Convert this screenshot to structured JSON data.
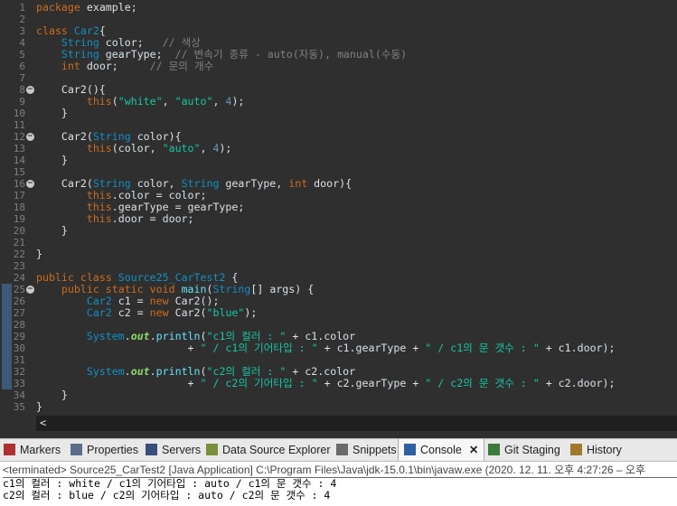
{
  "editor": {
    "line_numbers": [
      "1",
      "2",
      "3",
      "4",
      "5",
      "6",
      "7",
      "8",
      "9",
      "10",
      "11",
      "12",
      "13",
      "14",
      "15",
      "16",
      "17",
      "18",
      "19",
      "20",
      "21",
      "22",
      "23",
      "24",
      "25",
      "26",
      "27",
      "28",
      "29",
      "30",
      "31",
      "32",
      "33",
      "34",
      "35"
    ],
    "fold_markers": [
      "8",
      "12",
      "16",
      "25"
    ],
    "breakpoint_lines": [
      "25",
      "26",
      "27",
      "28",
      "29",
      "30",
      "31",
      "32",
      "33"
    ],
    "fold_glyph": "−",
    "lines": [
      [
        [
          "package",
          "k"
        ],
        [
          " example;",
          ""
        ]
      ],
      [],
      [
        [
          "class",
          "k"
        ],
        [
          " ",
          ""
        ],
        [
          "Car2",
          "cls"
        ],
        [
          "{",
          ""
        ]
      ],
      [
        [
          "    ",
          "w"
        ],
        [
          "String",
          "cls"
        ],
        [
          " color;   ",
          ""
        ],
        [
          "// 색상",
          "c"
        ]
      ],
      [
        [
          "    ",
          "w"
        ],
        [
          "String",
          "cls"
        ],
        [
          " gearType;  ",
          ""
        ],
        [
          "// 변속기 종류 - auto(자동), manual(수동)",
          "c"
        ]
      ],
      [
        [
          "    ",
          "w"
        ],
        [
          "int",
          "k"
        ],
        [
          " door;     ",
          ""
        ],
        [
          "// 문의 개수",
          "c"
        ]
      ],
      [
        [
          "    ",
          "w"
        ]
      ],
      [
        [
          "    ",
          "w"
        ],
        [
          "Car2(){",
          ""
        ]
      ],
      [
        [
          "        ",
          "w"
        ],
        [
          "this",
          "k"
        ],
        [
          "(",
          ""
        ],
        [
          "\"white\"",
          "s"
        ],
        [
          ", ",
          ""
        ],
        [
          "\"auto\"",
          "s"
        ],
        [
          ", ",
          ""
        ],
        [
          "4",
          "n"
        ],
        [
          ");",
          ""
        ]
      ],
      [
        [
          "    ",
          "w"
        ],
        [
          "}",
          ""
        ]
      ],
      [
        [
          "    ",
          "w"
        ]
      ],
      [
        [
          "    ",
          "w"
        ],
        [
          "Car2(",
          ""
        ],
        [
          "String",
          "cls"
        ],
        [
          " color){",
          ""
        ]
      ],
      [
        [
          "        ",
          "w"
        ],
        [
          "this",
          "k"
        ],
        [
          "(color, ",
          ""
        ],
        [
          "\"auto\"",
          "s"
        ],
        [
          ", ",
          ""
        ],
        [
          "4",
          "n"
        ],
        [
          ");",
          ""
        ]
      ],
      [
        [
          "    ",
          "w"
        ],
        [
          "}",
          ""
        ]
      ],
      [
        [
          "    ",
          "w"
        ]
      ],
      [
        [
          "    ",
          "w"
        ],
        [
          "Car2(",
          ""
        ],
        [
          "String",
          "cls"
        ],
        [
          " color, ",
          ""
        ],
        [
          "String",
          "cls"
        ],
        [
          " gearType, ",
          ""
        ],
        [
          "int",
          "k"
        ],
        [
          " door){",
          ""
        ]
      ],
      [
        [
          "        ",
          "w"
        ],
        [
          "this",
          "k"
        ],
        [
          ".color = color;",
          ""
        ]
      ],
      [
        [
          "        ",
          "w"
        ],
        [
          "this",
          "k"
        ],
        [
          ".gearType = gearType;",
          ""
        ]
      ],
      [
        [
          "        ",
          "w"
        ],
        [
          "this",
          "k"
        ],
        [
          ".door = door;",
          ""
        ]
      ],
      [
        [
          "    ",
          "w"
        ],
        [
          "}",
          ""
        ]
      ],
      [
        [
          "    ",
          "w"
        ]
      ],
      [
        [
          "}",
          ""
        ]
      ],
      [],
      [
        [
          "public",
          "k"
        ],
        [
          " ",
          ""
        ],
        [
          "class",
          "k"
        ],
        [
          " ",
          ""
        ],
        [
          "Source25_CarTest2",
          "cls"
        ],
        [
          " {",
          ""
        ]
      ],
      [
        [
          "    ",
          "w"
        ],
        [
          "public",
          "k"
        ],
        [
          " ",
          ""
        ],
        [
          "static",
          "k"
        ],
        [
          " ",
          ""
        ],
        [
          "void",
          "k"
        ],
        [
          " ",
          ""
        ],
        [
          "main",
          "f"
        ],
        [
          "(",
          ""
        ],
        [
          "String",
          "cls"
        ],
        [
          "[] args) {",
          ""
        ]
      ],
      [
        [
          "        ",
          "w"
        ],
        [
          "Car2",
          "cls"
        ],
        [
          " c1 = ",
          ""
        ],
        [
          "new",
          "k"
        ],
        [
          " Car2();",
          ""
        ]
      ],
      [
        [
          "        ",
          "w"
        ],
        [
          "Car2",
          "cls"
        ],
        [
          " c2 = ",
          ""
        ],
        [
          "new",
          "k"
        ],
        [
          " Car2(",
          ""
        ],
        [
          "\"blue\"",
          "s"
        ],
        [
          ");",
          ""
        ]
      ],
      [
        [
          "        ",
          "w"
        ]
      ],
      [
        [
          "        ",
          "w"
        ],
        [
          "System",
          "cls"
        ],
        [
          ".",
          ""
        ],
        [
          "out",
          "st"
        ],
        [
          ".",
          ""
        ],
        [
          "println",
          "f"
        ],
        [
          "(",
          ""
        ],
        [
          "\"c1의 컬러 : \"",
          "s"
        ],
        [
          " + c1.color",
          ""
        ]
      ],
      [
        [
          "                        ",
          "w"
        ],
        [
          "+ ",
          ""
        ],
        [
          "\" / c1의 기어타입 : \"",
          "s"
        ],
        [
          " + c1.gearType + ",
          ""
        ],
        [
          "\" / c1의 문 갯수 : \"",
          "s"
        ],
        [
          " + c1.door);",
          ""
        ]
      ],
      [
        [
          "        ",
          "w"
        ]
      ],
      [
        [
          "        ",
          "w"
        ],
        [
          "System",
          "cls"
        ],
        [
          ".",
          ""
        ],
        [
          "out",
          "st"
        ],
        [
          ".",
          ""
        ],
        [
          "println",
          "f"
        ],
        [
          "(",
          ""
        ],
        [
          "\"c2의 컬러 : \"",
          "s"
        ],
        [
          " + c2.color",
          ""
        ]
      ],
      [
        [
          "                        ",
          "w"
        ],
        [
          "+ ",
          ""
        ],
        [
          "\" / c2의 기어타입 : \"",
          "s"
        ],
        [
          " + c2.gearType + ",
          ""
        ],
        [
          "\" / c2의 문 갯수 : \"",
          "s"
        ],
        [
          " + c2.door);",
          ""
        ]
      ],
      [
        [
          "    ",
          "w"
        ],
        [
          "}",
          ""
        ]
      ],
      [
        [
          "}",
          ""
        ]
      ]
    ]
  },
  "hscroll_arrow": "<",
  "tabs": [
    {
      "label": "Markers",
      "icon": "markers-icon",
      "color": "#b03030"
    },
    {
      "label": "Properties",
      "icon": "properties-icon",
      "color": "#5a6d8a"
    },
    {
      "label": "Servers",
      "icon": "servers-icon",
      "color": "#3a4f7a"
    },
    {
      "label": "Data Source Explorer",
      "icon": "data-source-explorer-icon",
      "color": "#7a8f3a"
    },
    {
      "label": "Snippets",
      "icon": "snippets-icon",
      "color": "#6a6a6a"
    },
    {
      "label": "Console",
      "icon": "console-icon",
      "color": "#2f5f9f",
      "active": true,
      "close": "✕"
    },
    {
      "label": "Git Staging",
      "icon": "git-staging-icon",
      "color": "#3c7a3c"
    },
    {
      "label": "History",
      "icon": "history-icon",
      "color": "#a07a2a"
    }
  ],
  "console": {
    "status": "<terminated> Source25_CarTest2 [Java Application] C:\\Program Files\\Java\\jdk-15.0.1\\bin\\javaw.exe  (2020. 12. 11. 오후 4:27:26 – 오후",
    "output": [
      "c1의 컬러 : white / c1의 기어타입 : auto / c1의 문 갯수 : 4",
      "c2의 컬러 : blue / c2의 기어타입 : auto / c2의 문 갯수 : 4"
    ]
  }
}
